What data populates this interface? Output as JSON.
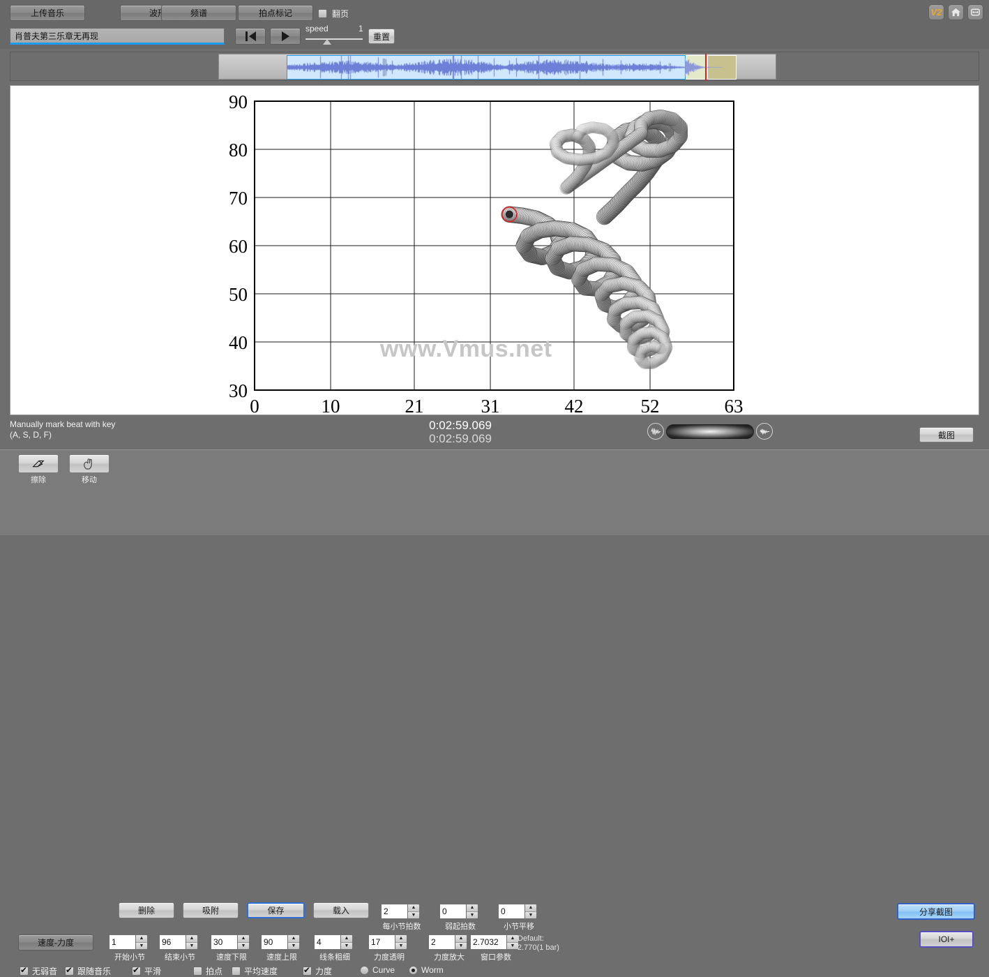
{
  "app": {
    "watermark": "www.Vmus.net",
    "version_badge": "V2"
  },
  "toolbar_top": {
    "buttons": [
      {
        "label": "上传音乐",
        "name": "upload-music-button"
      },
      {
        "label": "波形",
        "name": "waveform-button"
      },
      {
        "label": "频谱",
        "name": "spectrum-button"
      },
      {
        "label": "拍点标记",
        "name": "beat-mark-button"
      }
    ],
    "flip_page_checkbox": {
      "label": "翻页",
      "checked": false
    },
    "icons": [
      "version-badge",
      "home-icon",
      "fullscreen-icon"
    ]
  },
  "transport": {
    "title_value": "肖普夫第三乐章无再现",
    "title_placeholder": "",
    "rewind_label": "",
    "play_label": "",
    "speed_label": "speed",
    "speed_value": "1",
    "reset_label": "重置"
  },
  "status": {
    "hint_line1": "Manually mark beat with key",
    "hint_line2": "(A, S, D, F)",
    "time_current": "0:02:59.069",
    "time_total": "0:02:59.069",
    "capture_label": "截图"
  },
  "bottom": {
    "icon_tools": [
      {
        "label": "擦除",
        "icon": "eraser-icon",
        "name": "erase-tool"
      },
      {
        "label": "移动",
        "icon": "hand-icon",
        "name": "move-tool"
      }
    ],
    "text_buttons": [
      {
        "label": "删除",
        "name": "delete-button"
      },
      {
        "label": "吸附",
        "name": "snap-button"
      },
      {
        "label": "保存",
        "name": "save-button",
        "focused": true
      },
      {
        "label": "载入",
        "name": "load-button"
      }
    ],
    "mode_button": {
      "label": "速度-力度",
      "name": "tempo-dynamics-button"
    },
    "spinners": [
      {
        "name": "start-bar",
        "value": "1",
        "caption": "开始小节"
      },
      {
        "name": "end-bar",
        "value": "96",
        "caption": "结束小节"
      },
      {
        "name": "tempo-min",
        "value": "30",
        "caption": "速度下限"
      },
      {
        "name": "tempo-max",
        "value": "90",
        "caption": "速度上限"
      },
      {
        "name": "line-width",
        "value": "4",
        "caption": "线条粗细"
      },
      {
        "name": "beats-per-bar",
        "value": "2",
        "caption": "每小节拍数"
      },
      {
        "name": "pickup-beats",
        "value": "0",
        "caption": "弱起拍数"
      },
      {
        "name": "bar-shift",
        "value": "0",
        "caption": "小节平移"
      },
      {
        "name": "dynamics-alpha",
        "value": "17",
        "caption": "力度透明"
      },
      {
        "name": "dynamics-gain",
        "value": "2",
        "caption": "力度放大"
      },
      {
        "name": "window-param",
        "value": "2.7032",
        "caption": "窗口参数"
      }
    ],
    "default_note_line1": "Default:",
    "default_note_line2": "2.770(1 bar)",
    "checkboxes": [
      {
        "label": "无弱音",
        "checked": true,
        "name": "no-stem-checkbox"
      },
      {
        "label": "跟随音乐",
        "checked": true,
        "name": "follow-music-checkbox"
      },
      {
        "label": "平滑",
        "checked": true,
        "name": "smooth-checkbox"
      },
      {
        "label": "拍点",
        "checked": false,
        "name": "beat-point-checkbox"
      },
      {
        "label": "平均速度",
        "checked": false,
        "name": "average-tempo-checkbox"
      },
      {
        "label": "力度",
        "checked": true,
        "name": "dynamics-checkbox"
      }
    ],
    "radios": [
      {
        "label": "Curve",
        "selected": false,
        "name": "curve-radio"
      },
      {
        "label": "Worm",
        "selected": true,
        "name": "worm-radio"
      }
    ],
    "share_label": "分享截图",
    "ioi_label": "IOI+"
  },
  "chart_data": {
    "type": "scatter",
    "title": "",
    "xlabel": "",
    "ylabel": "",
    "xlim": [
      0,
      63
    ],
    "ylim": [
      30,
      90
    ],
    "xticks": [
      0,
      10,
      21,
      31,
      42,
      52,
      63
    ],
    "yticks": [
      30,
      40,
      50,
      60,
      70,
      80,
      90
    ],
    "grid": true,
    "legend": "none",
    "series": [
      {
        "name": "performance-worm",
        "description": "tempo-dynamics trajectory rendered as 3D worm ribbon",
        "head_marker": {
          "x": 33.5,
          "y": 66.5,
          "color": "#e02020"
        },
        "points": [
          [
            33.5,
            66.5
          ],
          [
            35.2,
            66.2
          ],
          [
            37.0,
            65.6
          ],
          [
            38.6,
            64.4
          ],
          [
            39.8,
            62.6
          ],
          [
            40.2,
            60.4
          ],
          [
            39.4,
            58.6
          ],
          [
            37.8,
            57.6
          ],
          [
            36.2,
            58.2
          ],
          [
            35.4,
            60.0
          ],
          [
            36.0,
            62.0
          ],
          [
            37.6,
            63.2
          ],
          [
            39.6,
            63.6
          ],
          [
            41.8,
            63.2
          ],
          [
            43.6,
            61.8
          ],
          [
            44.6,
            59.6
          ],
          [
            44.4,
            57.2
          ],
          [
            43.2,
            55.4
          ],
          [
            41.4,
            54.6
          ],
          [
            39.8,
            55.4
          ],
          [
            39.2,
            57.4
          ],
          [
            40.0,
            59.4
          ],
          [
            41.8,
            60.4
          ],
          [
            44.0,
            60.2
          ],
          [
            46.0,
            59.0
          ],
          [
            47.2,
            57.0
          ],
          [
            47.4,
            54.6
          ],
          [
            46.6,
            52.4
          ],
          [
            45.0,
            51.0
          ],
          [
            43.4,
            51.2
          ],
          [
            42.6,
            53.0
          ],
          [
            43.2,
            55.0
          ],
          [
            45.0,
            56.2
          ],
          [
            47.2,
            56.0
          ],
          [
            49.0,
            54.6
          ],
          [
            50.0,
            52.4
          ],
          [
            50.0,
            50.0
          ],
          [
            49.0,
            48.0
          ],
          [
            47.4,
            47.0
          ],
          [
            46.0,
            47.8
          ],
          [
            45.6,
            49.8
          ],
          [
            46.6,
            51.6
          ],
          [
            48.6,
            52.2
          ],
          [
            50.6,
            51.4
          ],
          [
            51.8,
            49.4
          ],
          [
            52.0,
            47.0
          ],
          [
            51.2,
            44.8
          ],
          [
            49.8,
            43.4
          ],
          [
            48.2,
            43.2
          ],
          [
            47.2,
            44.6
          ],
          [
            47.4,
            46.6
          ],
          [
            48.8,
            48.0
          ],
          [
            50.8,
            48.2
          ],
          [
            52.4,
            47.0
          ],
          [
            53.0,
            44.8
          ],
          [
            52.6,
            42.6
          ],
          [
            51.4,
            41.0
          ],
          [
            49.8,
            40.6
          ],
          [
            48.8,
            41.8
          ],
          [
            48.8,
            43.8
          ],
          [
            50.0,
            45.2
          ],
          [
            51.8,
            45.4
          ],
          [
            53.2,
            44.2
          ],
          [
            53.8,
            42.2
          ],
          [
            53.4,
            40.0
          ],
          [
            52.2,
            38.4
          ],
          [
            50.8,
            37.8
          ],
          [
            49.8,
            38.6
          ],
          [
            49.8,
            40.4
          ],
          [
            51.0,
            41.8
          ],
          [
            52.6,
            42.0
          ],
          [
            53.8,
            40.8
          ],
          [
            54.2,
            38.8
          ],
          [
            53.6,
            36.8
          ],
          [
            52.4,
            35.6
          ],
          [
            51.2,
            35.6
          ],
          [
            50.6,
            36.8
          ],
          [
            51.0,
            38.4
          ],
          [
            52.2,
            39.2
          ],
          [
            53.4,
            38.6
          ],
          [
            46.0,
            66.0
          ],
          [
            47.6,
            68.4
          ],
          [
            49.0,
            70.8
          ],
          [
            50.4,
            73.0
          ],
          [
            51.6,
            75.2
          ],
          [
            52.6,
            77.4
          ],
          [
            53.2,
            79.6
          ],
          [
            53.0,
            81.8
          ],
          [
            52.0,
            83.4
          ],
          [
            50.4,
            84.2
          ],
          [
            48.8,
            83.8
          ],
          [
            47.6,
            82.4
          ],
          [
            47.2,
            80.4
          ],
          [
            47.8,
            78.4
          ],
          [
            49.2,
            77.2
          ],
          [
            51.0,
            77.0
          ],
          [
            52.8,
            77.8
          ],
          [
            54.2,
            79.4
          ],
          [
            55.0,
            81.4
          ],
          [
            55.0,
            83.4
          ],
          [
            54.2,
            85.0
          ],
          [
            52.8,
            85.8
          ],
          [
            51.2,
            85.6
          ],
          [
            50.0,
            84.4
          ],
          [
            49.6,
            82.6
          ],
          [
            50.2,
            80.8
          ],
          [
            51.6,
            79.8
          ],
          [
            53.4,
            79.8
          ],
          [
            55.0,
            80.8
          ],
          [
            56.0,
            82.6
          ],
          [
            56.0,
            84.6
          ],
          [
            55.0,
            86.2
          ],
          [
            53.4,
            86.8
          ],
          [
            51.8,
            86.4
          ],
          [
            50.8,
            85.0
          ],
          [
            50.8,
            83.2
          ],
          [
            41.0,
            72.0
          ],
          [
            42.4,
            74.2
          ],
          [
            43.4,
            76.4
          ],
          [
            44.0,
            78.6
          ],
          [
            44.0,
            80.6
          ],
          [
            43.2,
            82.2
          ],
          [
            41.8,
            83.0
          ],
          [
            40.4,
            82.6
          ],
          [
            39.6,
            81.2
          ],
          [
            39.8,
            79.4
          ],
          [
            41.0,
            78.2
          ],
          [
            42.8,
            77.8
          ],
          [
            44.8,
            78.2
          ],
          [
            46.4,
            79.4
          ],
          [
            47.2,
            81.2
          ],
          [
            47.0,
            83.0
          ],
          [
            46.0,
            84.2
          ],
          [
            44.4,
            84.6
          ],
          [
            43.0,
            84.0
          ],
          [
            42.4,
            82.6
          ]
        ]
      }
    ]
  }
}
